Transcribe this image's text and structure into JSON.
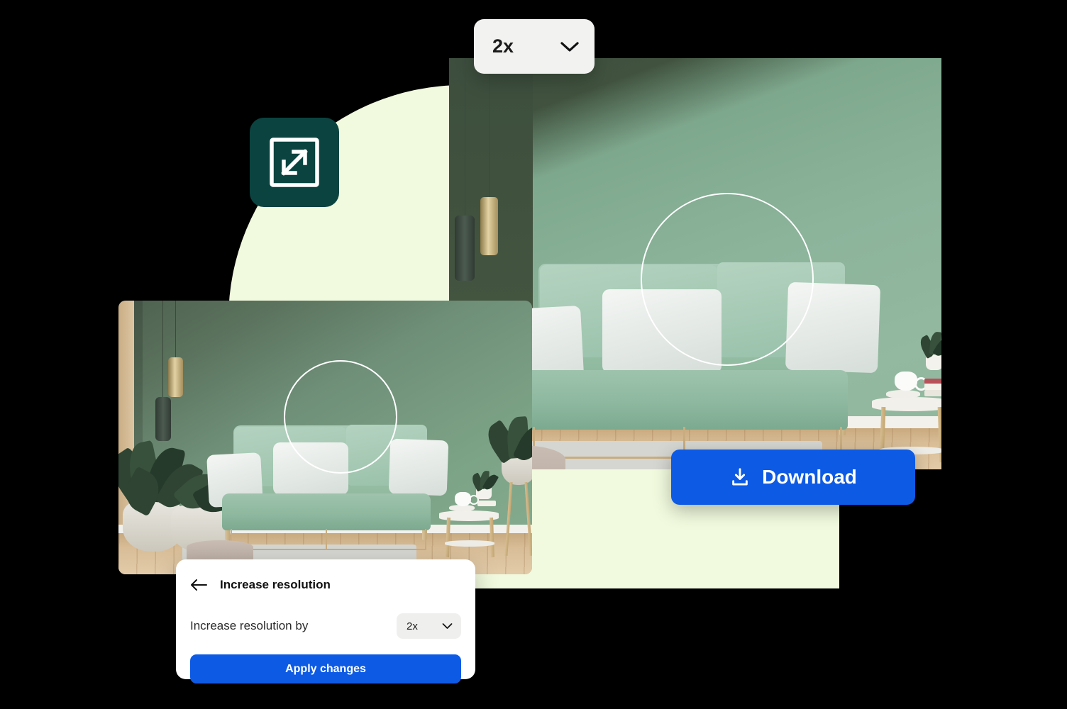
{
  "app": {
    "feature_name": "Increase resolution",
    "icon_name": "expand-resolution-icon",
    "teal": "#0b4340",
    "accent_blue": "#0d5ae5",
    "pale_green": "#f1fade"
  },
  "top_control": {
    "name": "scale-select",
    "value": "2x",
    "chevron_icon": "chevron-down-icon"
  },
  "download": {
    "label": "Download",
    "icon": "download-icon"
  },
  "panel": {
    "back_icon": "arrow-left-icon",
    "title": "Increase resolution",
    "field_label": "Increase resolution by",
    "field_value": "2x",
    "field_chevron_icon": "chevron-down-icon",
    "apply_label": "Apply changes"
  },
  "previews": {
    "before": {
      "name": "low-resolution-preview",
      "alt": "Living room with green sofa, pillows, plants and side table"
    },
    "after": {
      "name": "high-resolution-preview",
      "alt": "Upscaled living room with green sofa, pillows and side table"
    },
    "loupe_name": "zoom-loupe-circle"
  }
}
